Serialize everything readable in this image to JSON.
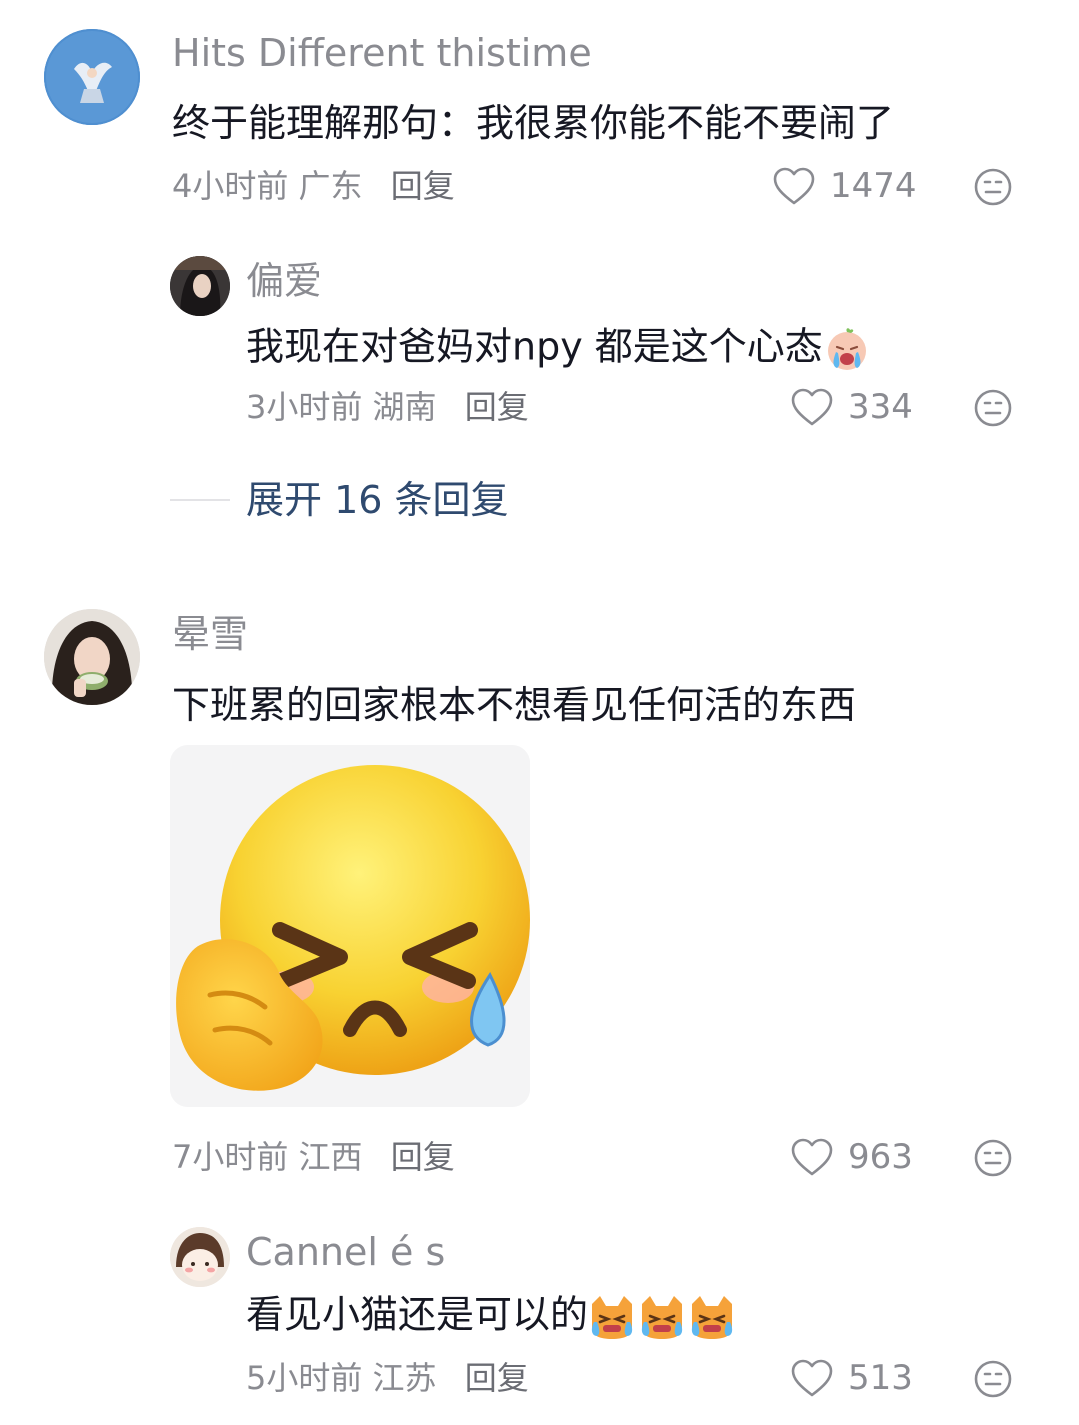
{
  "comments": [
    {
      "username": "Hits Different thistime",
      "text": "终于能理解那句：我很累你能不能不要闹了",
      "time": "4小时前",
      "location": "广东",
      "reply_label": "回复",
      "likes": "1474",
      "replies": [
        {
          "username": "偏爱",
          "text": "我现在对爸妈对npy 都是这个心态",
          "emoji": "crying-baby-emoji",
          "time": "3小时前",
          "location": "湖南",
          "reply_label": "回复",
          "likes": "334"
        }
      ],
      "expand_label": "展开 16 条回复"
    },
    {
      "username": "晕雪",
      "text": "下班累的回家根本不想看见任何活的东西",
      "sticker": "facepalm-tears-sticker",
      "time": "7小时前",
      "location": "江西",
      "reply_label": "回复",
      "likes": "963",
      "replies": [
        {
          "username": "Cannel é s",
          "text": "看见小猫还是可以的",
          "emoji": "crying-cat-emoji x3",
          "time": "5小时前",
          "location": "江苏",
          "reply_label": "回复",
          "likes": "513"
        }
      ]
    }
  ],
  "colors": {
    "primary_text": "#161823",
    "secondary_text": "#8a8b91",
    "expand_link": "#2f4a6f",
    "background": "#ffffff"
  }
}
